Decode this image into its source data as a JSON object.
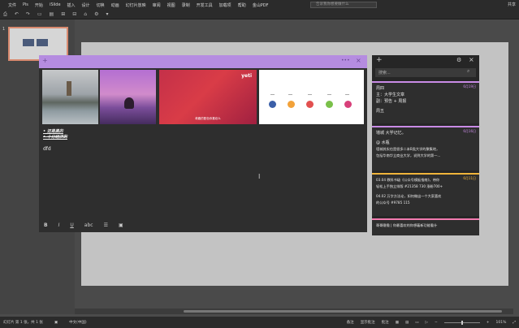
{
  "ribbon": {
    "tabs": [
      "文件",
      "Pis",
      "开始",
      "iSlide",
      "插入",
      "设计",
      "切换",
      "动画",
      "幻灯片放映",
      "审阅",
      "视图",
      "录制",
      "开发工具",
      "加载项",
      "帮助",
      "金山PDF"
    ],
    "search_placeholder": "告诉我你想要做什么",
    "user": "共享"
  },
  "quick_access": [
    "⎙",
    "↶",
    "↷",
    "▭",
    "▤",
    "⊞",
    "⊟",
    "⌂",
    "⚙",
    "▾"
  ],
  "slide_panel": {
    "slide_number": "1"
  },
  "note": {
    "images": [
      {
        "caption": ""
      },
      {
        "caption": ""
      },
      {
        "caption": "奇趣的配色你喜欢么",
        "logo": "yeti"
      },
      {
        "caption": ""
      }
    ],
    "line1": "• 还是黑的",
    "line2": "• 十分经济的",
    "line3": "dfd",
    "toolbar": [
      "B",
      "I",
      "U",
      "abc",
      "☰",
      "▣"
    ]
  },
  "list": {
    "search_placeholder": "搜索...",
    "cards": [
      {
        "date": "6月19日",
        "lines": [
          "周四",
          "主：大学生文章",
          "副：预告 + 周报",
          "",
          "周五"
        ]
      },
      {
        "date": "6月16日",
        "lines": [
          "墙城 大学记忆。",
          "",
          "@ 水瓶",
          "墙城其实也是很多二本B类大学的聚集地，",
          "包括华南华立商业大学，说到大学的第一..."
        ]
      },
      {
        "date": "6月11日",
        "lines": [
          "03.04 教科书级《公众号模板指南》，带你",
          "轻松上手独立排版  #21358  730  涨粉700+",
          "",
          "04.02 万字方法论，如何做出一个大家喜欢",
          "的公众号  #9785  115"
        ]
      },
      {
        "date": "",
        "lines": [
          "哥哥嗷嗷 | 你最喜欢的你想着新功能看什"
        ]
      }
    ]
  },
  "status": {
    "slide_info": "幻灯片 第 1 张，共 1 张",
    "language": "中文(中国)",
    "notes": "备注",
    "comments": "显示批注",
    "review": "批注",
    "zoom": "101%"
  },
  "colors": {
    "accent_purple": "#b58ce0",
    "orange": "#f0b43a",
    "pink": "#f27bb0"
  }
}
